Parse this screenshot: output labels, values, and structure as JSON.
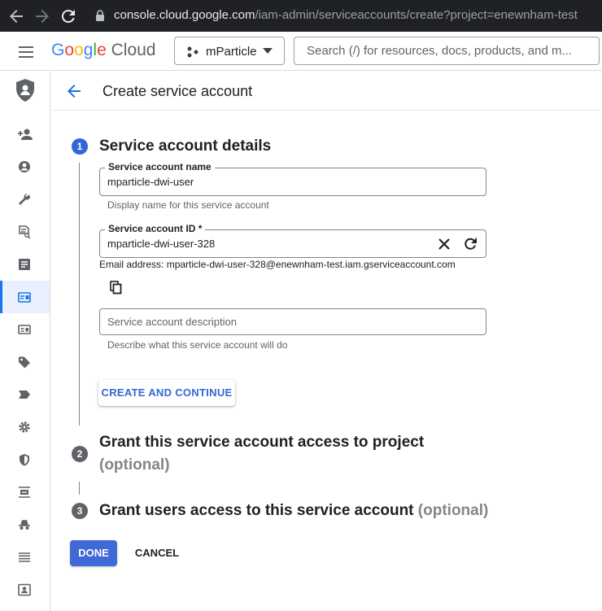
{
  "browser": {
    "url_host": "console.cloud.google.com",
    "url_path": "/iam-admin/serviceaccounts/create?project=enewnham-test"
  },
  "header": {
    "logo_google": [
      "G",
      "o",
      "o",
      "g",
      "l",
      "e"
    ],
    "logo_cloud": "Cloud",
    "project": "mParticle",
    "search_placeholder": "Search (/) for resources, docs, products, and m..."
  },
  "page": {
    "title": "Create service account"
  },
  "steps": [
    {
      "number": "1",
      "title": "Service account details"
    },
    {
      "number": "2",
      "title_line1": "Grant this service account access to project",
      "optional": "(optional)"
    },
    {
      "number": "3",
      "title": "Grant users access to this service account",
      "optional": "(optional)"
    }
  ],
  "form": {
    "name_label": "Service account name",
    "name_value": "mparticle-dwi-user",
    "name_hint": "Display name for this service account",
    "id_label": "Service account ID *",
    "id_value": "mparticle-dwi-user-328",
    "email_text": "Email address: mparticle-dwi-user-328@enewnham-test.iam.gserviceaccount.com",
    "description_placeholder": "Service account description",
    "description_hint": "Describe what this service account will do",
    "create_button": "CREATE AND CONTINUE"
  },
  "footer": {
    "done": "DONE",
    "cancel": "CANCEL"
  },
  "rail_icons": [
    "person-add-icon",
    "account-circle-icon",
    "wrench-icon",
    "policy-doc-icon",
    "document-icon",
    "service-accounts-icon",
    "id-card-icon",
    "tag-icon",
    "label-icon",
    "settings-gear-icon",
    "shield-icon",
    "audit-list-icon",
    "incognito-icon",
    "list-icon",
    "contact-card-icon"
  ],
  "colors": {
    "accent": "#1a73e8",
    "done_button": "#3f69d6",
    "step_active": "#3367d6",
    "step_inactive": "#5f6368"
  }
}
